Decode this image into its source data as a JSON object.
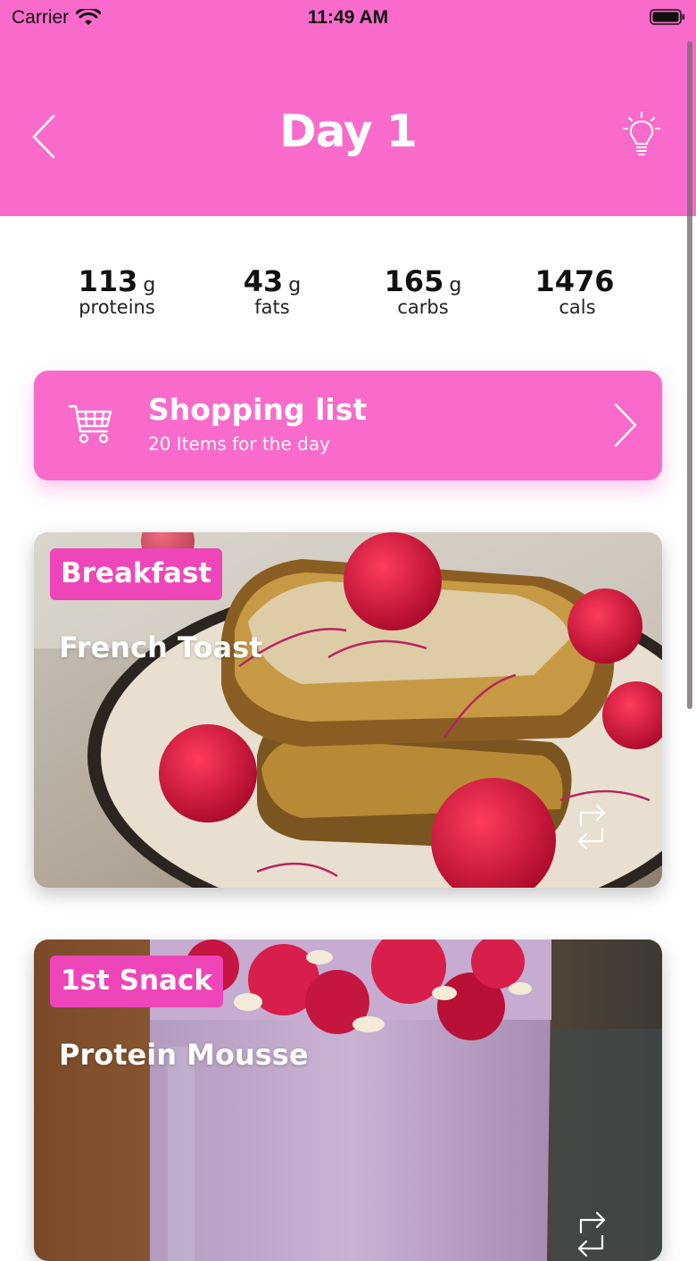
{
  "status_bar": {
    "carrier": "Carrier",
    "time": "11:49 AM"
  },
  "header": {
    "title": "Day 1",
    "background": "#f86bcb"
  },
  "macros": [
    {
      "value": "113",
      "unit": "g",
      "label": "proteins"
    },
    {
      "value": "43",
      "unit": "g",
      "label": "fats"
    },
    {
      "value": "165",
      "unit": "g",
      "label": "carbs"
    },
    {
      "value": "1476",
      "unit": "",
      "label": "cals"
    }
  ],
  "shopping_list": {
    "title": "Shopping list",
    "subtitle": "20 Items for the day"
  },
  "meals": [
    {
      "tag": "Breakfast",
      "name": "French Toast"
    },
    {
      "tag": "1st Snack",
      "name": "Protein Mousse"
    }
  ],
  "icons": {
    "back": "chevron-left-icon",
    "tips": "lightbulb-icon",
    "cart": "shopping-cart-icon",
    "forward": "chevron-right-icon",
    "swap": "swap-icon"
  },
  "colors": {
    "accent": "#f86bcb",
    "tag": "#ee45b8"
  }
}
